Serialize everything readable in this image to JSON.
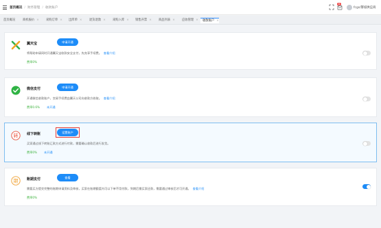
{
  "header": {
    "breadcrumb": [
      "首页概况",
      "财务管理",
      "收款账户"
    ],
    "notification_count": "8",
    "user_name": "fcgs/擎城供应商"
  },
  "tabs": [
    {
      "label": "首页概况",
      "active": false
    },
    {
      "label": "商机报价",
      "active": false
    },
    {
      "label": "采购订单",
      "active": false
    },
    {
      "label": "出库单",
      "active": false
    },
    {
      "label": "退货退款",
      "active": false
    },
    {
      "label": "采购入库",
      "active": false
    },
    {
      "label": "销售开票",
      "active": false
    },
    {
      "label": "商品列表",
      "active": false
    },
    {
      "label": "应收管理",
      "active": false
    },
    {
      "label": "收款账户",
      "active": true
    }
  ],
  "payments": [
    {
      "name": "翼天宝",
      "button": "申请开通",
      "description": "将帮助申请同时开通翼天宝收款安全支付，先充享手续费。",
      "link": "查看介绍",
      "rate": "费率0%",
      "extra_link": "",
      "enabled": false,
      "highlight": false,
      "selected": false
    },
    {
      "name": "微信支付",
      "button": "申请开通",
      "description": "开通微信收款账户，交易手续费由翼天公司向收款方收取。",
      "link": "查看介绍",
      "rate": "费率0.6%",
      "extra_link": "未开通",
      "enabled": false,
      "highlight": false,
      "selected": false
    },
    {
      "name": "线下转账",
      "button": "设置账户",
      "description": "买家通过线下转账汇款方式进行付款，需要确认收款后进行发货。",
      "link": "",
      "rate": "费率0%",
      "extra_link": "未开通",
      "enabled": false,
      "highlight": true,
      "selected": true
    },
    {
      "name": "账期支付",
      "button": "查看",
      "description": "需要买方提交完整的账期申请资料及审核，买家在账期额度内可以下单不用付款，到期后需买家还款，需要通过审核后才可开通。",
      "link": "查看介绍",
      "rate": "费率0%",
      "extra_link": "",
      "enabled": true,
      "highlight": false,
      "selected": false
    }
  ],
  "colors": {
    "accent": "#1d8cf8",
    "rate_green": "#3fb33f",
    "highlight_red": "#e53935"
  }
}
